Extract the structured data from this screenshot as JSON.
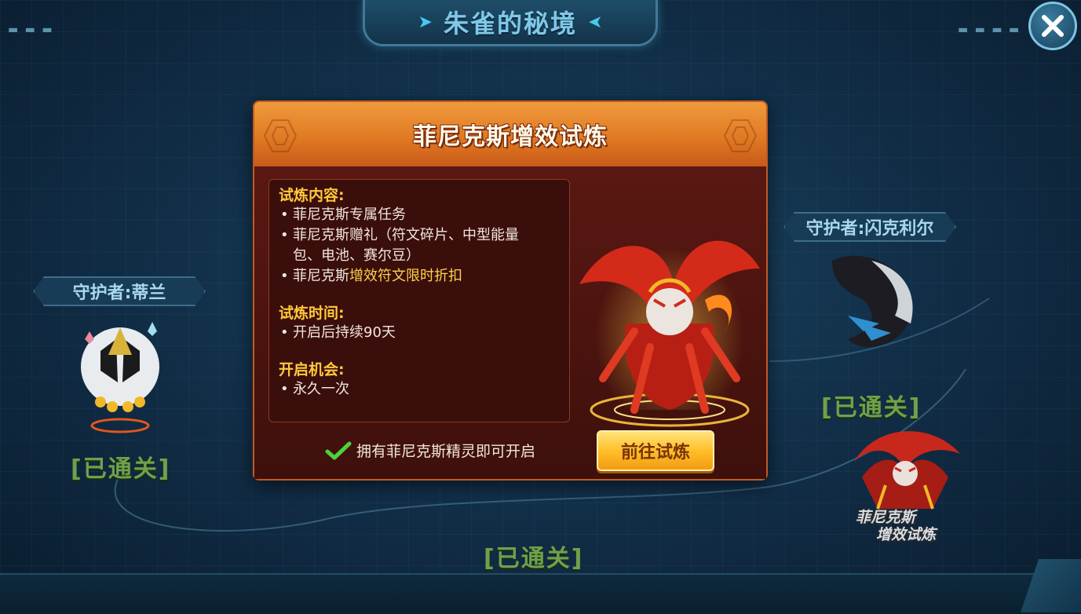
{
  "header": {
    "title": "朱雀的秘境",
    "close_icon": "close-icon"
  },
  "map": {
    "guardian_left": "守护者:蒂兰",
    "guardian_right": "守护者:闪克利尔",
    "cleared_left": "[已通关]",
    "cleared_right": "[已通关]",
    "cleared_bottom": "[已通关]",
    "side_trial_line1": "菲尼克斯",
    "side_trial_line2": "增效试炼"
  },
  "modal": {
    "title": "菲尼克斯增效试炼",
    "content_title": "试炼内容:",
    "content_items": {
      "item1": "菲尼克斯专属任务",
      "item2_line1": "菲尼克斯赠礼（符文碎片、中型能量",
      "item2_line2": "包、电池、赛尔豆）",
      "item3_prefix": "菲尼克斯",
      "item3_highlight": "增效符文限时折扣"
    },
    "time_title": "试炼时间:",
    "time_item": "开启后持续90天",
    "chance_title": "开启机会:",
    "chance_item": "永久一次",
    "requirement": "拥有菲尼克斯精灵即可开启",
    "go_button": "前往试炼"
  },
  "colors": {
    "accent_orange": "#e07a24",
    "highlight_yellow": "#ffd24a",
    "cleared_green": "#6fa14a",
    "check_green": "#4fd13a"
  }
}
